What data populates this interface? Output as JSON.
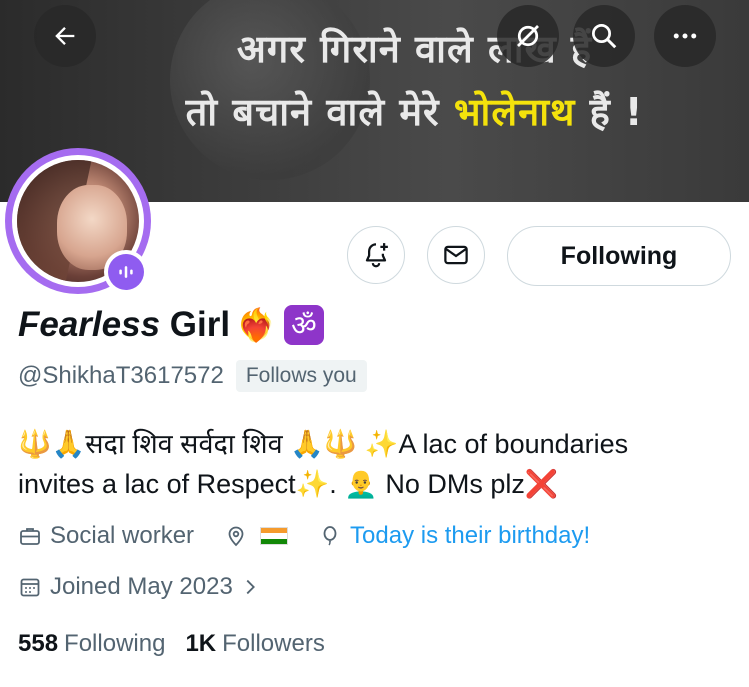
{
  "banner": {
    "line1": "अगर गिराने वाले लाख हैं",
    "line2_main": "तो बचाने वाले मेरे ",
    "line2_highlight": "भोलेनाथ",
    "line2_end": " हैं !"
  },
  "top_buttons": {
    "back_icon": "arrow-left-icon",
    "grok_icon": "grok-icon",
    "search_icon": "search-icon",
    "more_icon": "more-icon"
  },
  "profile": {
    "name_italic": "Fearless",
    "name_rest": " Girl",
    "name_emoji_heart": "❤‍🔥",
    "name_emoji_om": "ॐ",
    "handle": "@ShikhaT3617572",
    "follows_you": "Follows you",
    "bio_part1": "🔱🙏सदा शिव सर्वदा शिव 🙏🔱 ✨A lac of boundaries",
    "bio_part2": "invites a lac of Respect✨. 👨‍🦲 No DMs plz",
    "bio_cross": "❌",
    "occupation": "Social worker",
    "location_flag": "India flag",
    "birthday": "Today is their birthday!",
    "joined": "Joined May 2023",
    "following_count": "558",
    "following_label": "Following",
    "followers_count": "1K",
    "followers_label": "Followers"
  },
  "actions": {
    "following_button": "Following"
  },
  "colors": {
    "accent_blue": "#1d9bf0",
    "avatar_ring": "#a56cf0",
    "secondary_text": "#536471"
  }
}
